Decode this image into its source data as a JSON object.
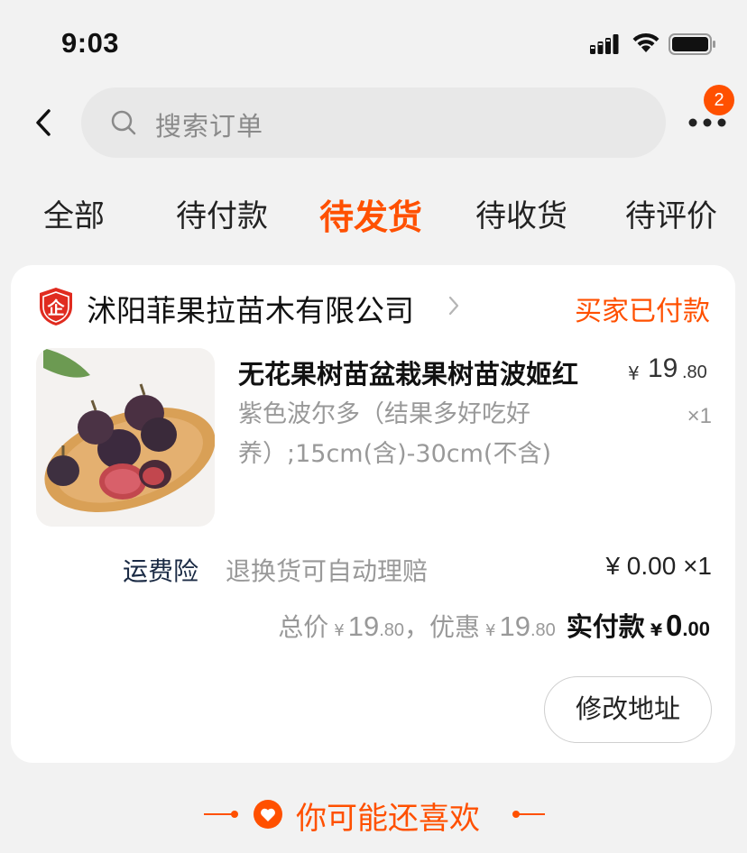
{
  "status_bar": {
    "time": "9:03"
  },
  "header": {
    "search_placeholder": "搜索订单",
    "more_badge": "2"
  },
  "tabs": [
    {
      "label": "全部"
    },
    {
      "label": "待付款"
    },
    {
      "label": "待发货",
      "active": true
    },
    {
      "label": "待收货"
    },
    {
      "label": "待评价"
    }
  ],
  "order": {
    "shop_name": "沭阳菲果拉苗木有限公司",
    "status": "买家已付款",
    "product": {
      "title": "无花果树苗盆栽果树苗波姬红",
      "price_currency": "¥",
      "price_int": "19",
      "price_dec": ".80",
      "spec": "紫色波尔多（结果多好吃好养）;15cm(含)-30cm(不含)",
      "quantity": "×1"
    },
    "insurance": {
      "label": "运费险",
      "description": "退换货可自动理赔",
      "amount": "¥ 0.00 ×1"
    },
    "totals": {
      "total_label": "总价",
      "total_currency": "¥",
      "total_int": "19",
      "total_dec": ".80",
      "discount_label": "，优惠",
      "discount_currency": "¥",
      "discount_int": "19",
      "discount_dec": ".80",
      "paid_label": "实付款",
      "paid_currency": "¥",
      "paid_int": "0",
      "paid_dec": ".00"
    },
    "modify_address_label": "修改地址"
  },
  "recommend": {
    "label": "你可能还喜欢"
  },
  "colors": {
    "accent": "#ff5000",
    "background": "#f2f2f2"
  }
}
